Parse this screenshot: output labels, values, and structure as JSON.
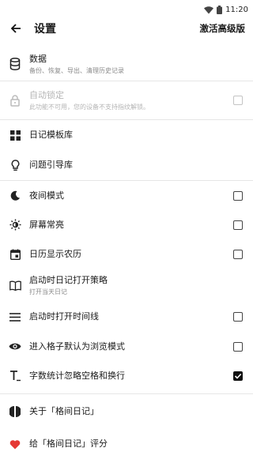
{
  "status": {
    "time": "11:20"
  },
  "header": {
    "title": "设置",
    "action": "激活高级版"
  },
  "rows": [
    {
      "label": "数据",
      "sub": "备份、恢复、导出、清理历史记录"
    },
    {
      "label": "自动锁定",
      "sub": "此功能不可用，您的设备不支持指纹解锁。",
      "disabled": true,
      "checked": false
    },
    {
      "label": "日记模板库"
    },
    {
      "label": "问题引导库"
    },
    {
      "label": "夜间模式",
      "checked": false
    },
    {
      "label": "屏幕常亮",
      "checked": false
    },
    {
      "label": "日历显示农历",
      "checked": false
    },
    {
      "label": "启动时日记打开策略",
      "sub": "打开当天日记"
    },
    {
      "label": "启动时打开时间线",
      "checked": false
    },
    {
      "label": "进入格子默认为浏览模式",
      "checked": false
    },
    {
      "label": "字数统计忽略空格和换行",
      "checked": true
    },
    {
      "label": "关于「格间日记」"
    },
    {
      "label": "给「格间日记」评分"
    }
  ],
  "icons": [
    "wifi-icon",
    "battery-icon",
    "back-arrow-icon",
    "database-icon",
    "lock-icon",
    "grid-icon",
    "lightbulb-icon",
    "moon-icon",
    "brightness-icon",
    "calendar-icon",
    "book-icon",
    "menu-lines-icon",
    "eye-icon",
    "text-count-icon",
    "app-logo-icon",
    "heart-icon"
  ],
  "colors": {
    "heart": "#e53935",
    "checkbox_on": "#111111",
    "disabled_text": "#b5b5b5"
  }
}
